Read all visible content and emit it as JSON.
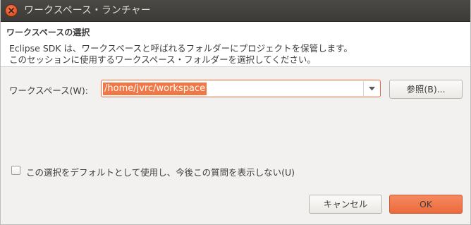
{
  "window": {
    "title": "ワークスペース・ランチャー"
  },
  "header": {
    "title": "ワークスペースの選択",
    "description": [
      "Eclipse SDK は、ワークスペースと呼ばれるフォルダーにプロジェクトを保管します。",
      "このセッションに使用するワークスペース・フォルダーを選択してください。"
    ]
  },
  "workspace": {
    "label": "ワークスペース(W):",
    "value": "/home/jvrc/workspace",
    "browse_label": "参照(B)..."
  },
  "options": {
    "dont_ask_label": "この選択をデフォルトとして使用し、今後この質問を表示しない(U)",
    "dont_ask_checked": false
  },
  "actions": {
    "cancel_label": "キャンセル",
    "ok_label": "OK"
  },
  "colors": {
    "accent": "#f07746",
    "titlebar": "#3c3b37",
    "close_button": "#e0552a"
  },
  "icons": {
    "close": "close-icon",
    "dropdown": "chevron-down-icon"
  }
}
